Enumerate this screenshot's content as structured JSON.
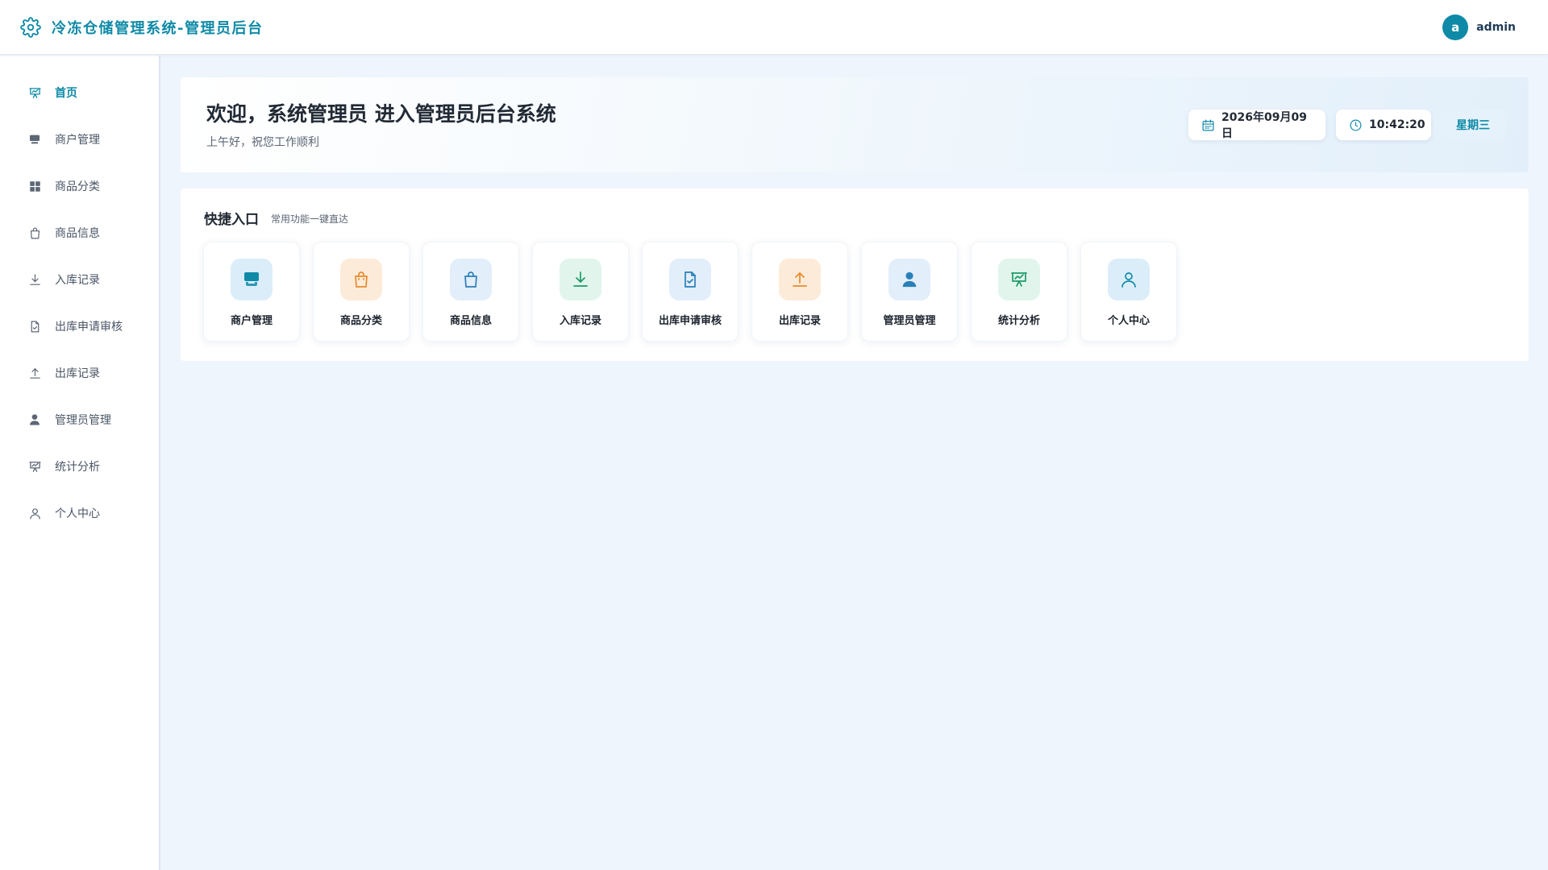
{
  "header": {
    "brand_icon": "gear-icon",
    "title": "冷冻仓储管理系统-管理员后台",
    "user": {
      "avatar_letter": "a",
      "name": "admin"
    }
  },
  "sidebar": {
    "items": [
      {
        "label": "首页",
        "icon": "presentation-chart-icon",
        "active": true
      },
      {
        "label": "商户管理",
        "icon": "store-icon"
      },
      {
        "label": "商品分类",
        "icon": "grid-icon"
      },
      {
        "label": "商品信息",
        "icon": "shopping-bag-icon"
      },
      {
        "label": "入库记录",
        "icon": "download-icon"
      },
      {
        "label": "出库申请审核",
        "icon": "document-check-icon"
      },
      {
        "label": "出库记录",
        "icon": "upload-icon"
      },
      {
        "label": "管理员管理",
        "icon": "user-filled-icon"
      },
      {
        "label": "统计分析",
        "icon": "presentation-chart-icon"
      },
      {
        "label": "个人中心",
        "icon": "user-outline-icon"
      }
    ]
  },
  "welcome": {
    "title": "欢迎，系统管理员 进入管理员后台系统",
    "subtitle": "上午好，祝您工作顺利",
    "date": "2026年09月09日",
    "time": "10:42:20",
    "weekday": "星期三"
  },
  "quick": {
    "title": "快捷入口",
    "subtitle": "常用功能一键直达",
    "cards": [
      {
        "label": "商户管理",
        "icon": "store-icon",
        "color": "#0e8aa7"
      },
      {
        "label": "商品分类",
        "icon": "shopping-bag-icon",
        "color": "#e88a2c"
      },
      {
        "label": "商品信息",
        "icon": "shopping-bag-icon",
        "color": "#2a7fb8"
      },
      {
        "label": "入库记录",
        "icon": "download-icon",
        "color": "#1e9a6a"
      },
      {
        "label": "出库申请审核",
        "icon": "document-check-icon",
        "color": "#2a7fb8"
      },
      {
        "label": "出库记录",
        "icon": "upload-icon",
        "color": "#e88a2c"
      },
      {
        "label": "管理员管理",
        "icon": "user-filled-icon",
        "color": "#2a7fb8"
      },
      {
        "label": "统计分析",
        "icon": "presentation-chart-icon",
        "color": "#1e9a6a"
      },
      {
        "label": "个人中心",
        "icon": "user-outline-icon",
        "color": "#0e8aa7"
      }
    ]
  },
  "colors": {
    "accent": "#0e8aa7",
    "page_background": "#eef5fc"
  }
}
